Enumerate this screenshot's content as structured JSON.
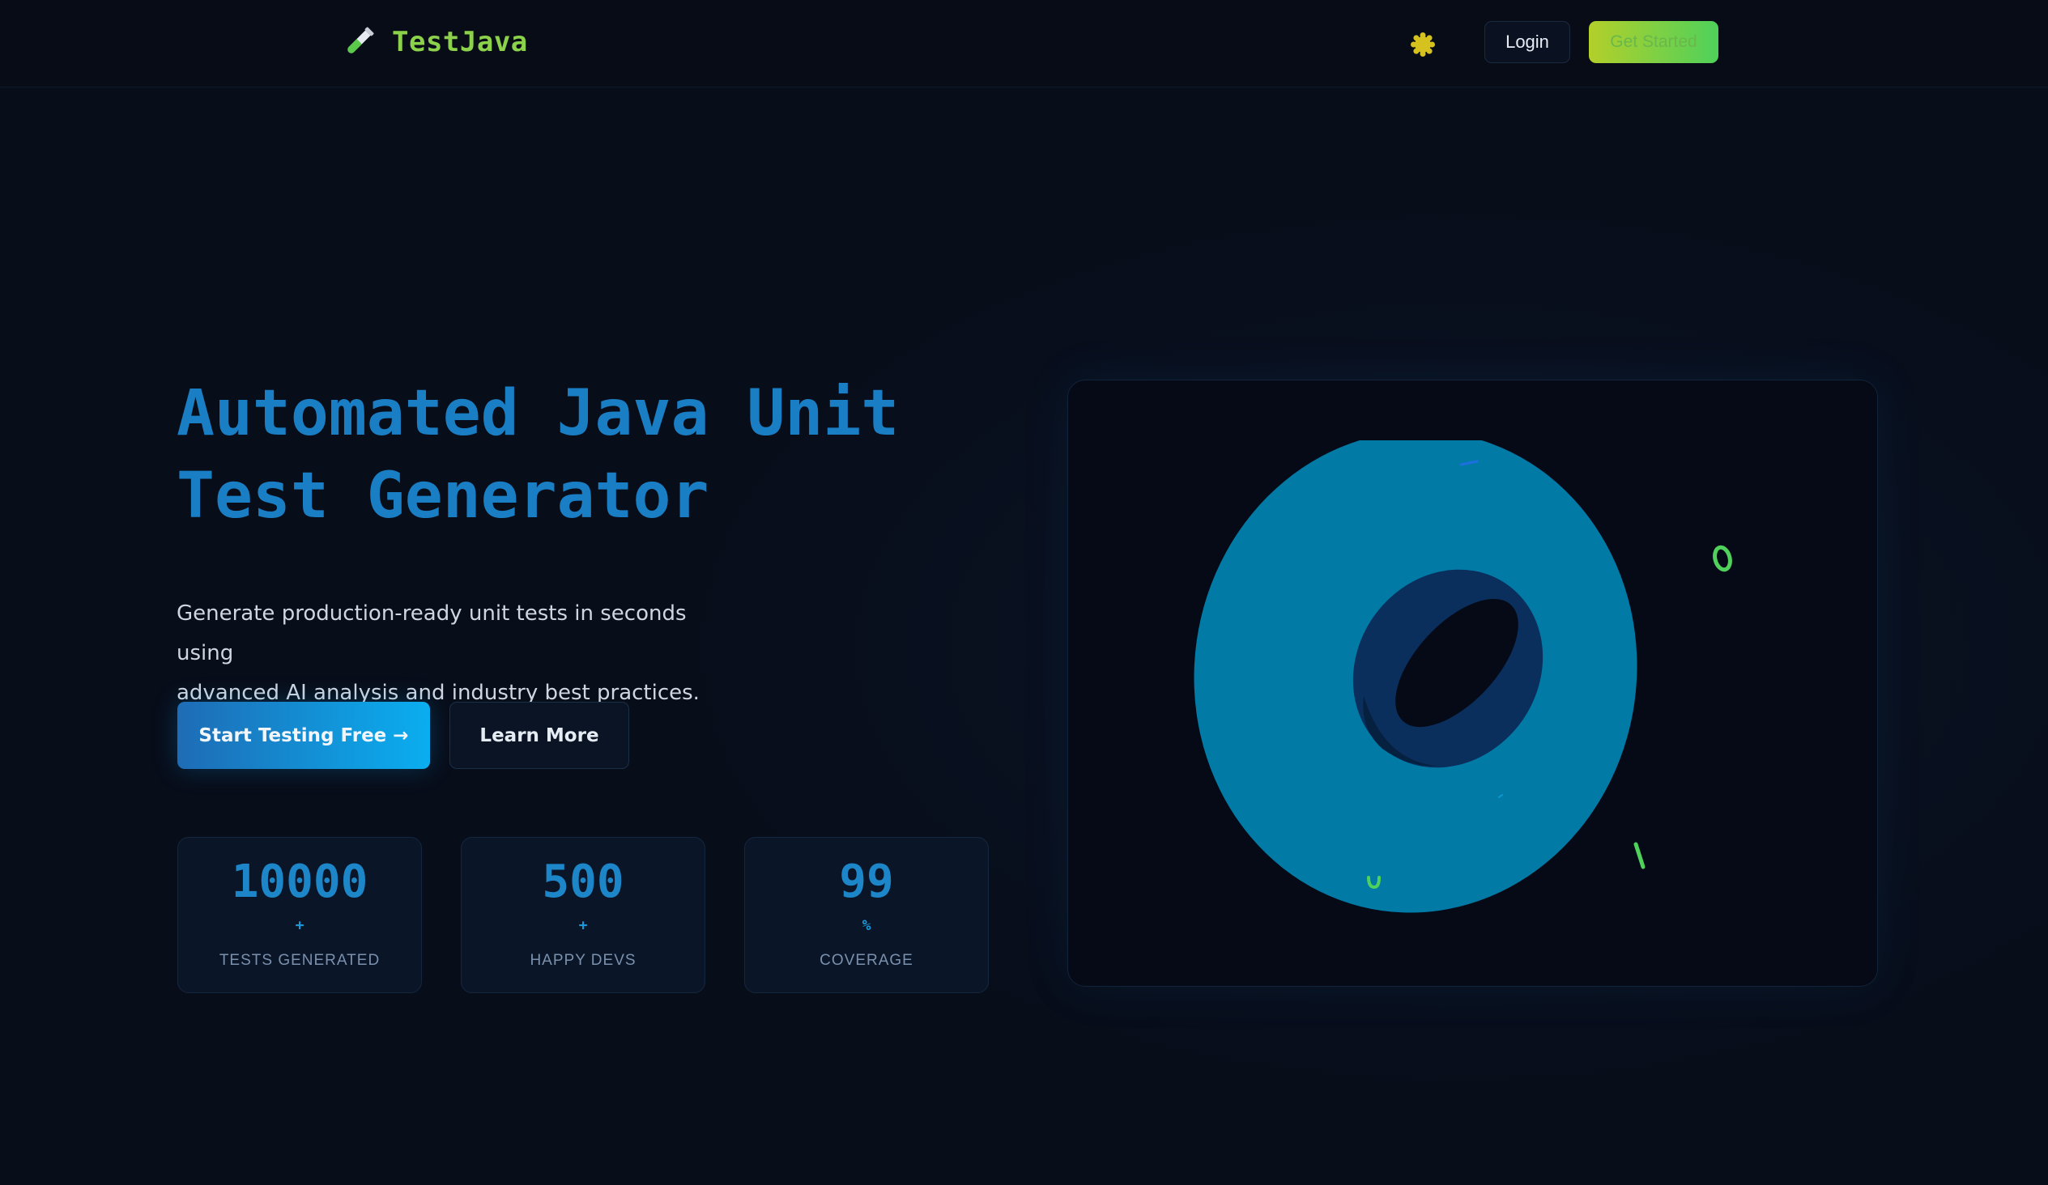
{
  "nav": {
    "brand": "TestJava",
    "login_label": "Login",
    "get_started_label": "Get Started"
  },
  "hero": {
    "title_line1": "Automated Java Unit",
    "title_line2": "Test Generator",
    "subtitle_line1": "Generate production-ready unit tests in seconds using",
    "subtitle_line2": "advanced AI analysis and industry best practices.",
    "primary_cta": "Start Testing Free →",
    "secondary_cta": "Learn More"
  },
  "stats": [
    {
      "value": "10000",
      "suffix": "+",
      "label": "TESTS GENERATED"
    },
    {
      "value": "500",
      "suffix": "+",
      "label": "HAPPY DEVS"
    },
    {
      "value": "99",
      "suffix": "%",
      "label": "COVERAGE"
    }
  ],
  "icons": {
    "brand": "test-tube-icon",
    "theme": "sun-icon"
  },
  "colors": {
    "background": "#080d1a",
    "accent_blue": "#1a7ec4",
    "accent_green": "#4fd15b",
    "torus": "#017aa6",
    "torus_hole": "#0a2f5c"
  }
}
